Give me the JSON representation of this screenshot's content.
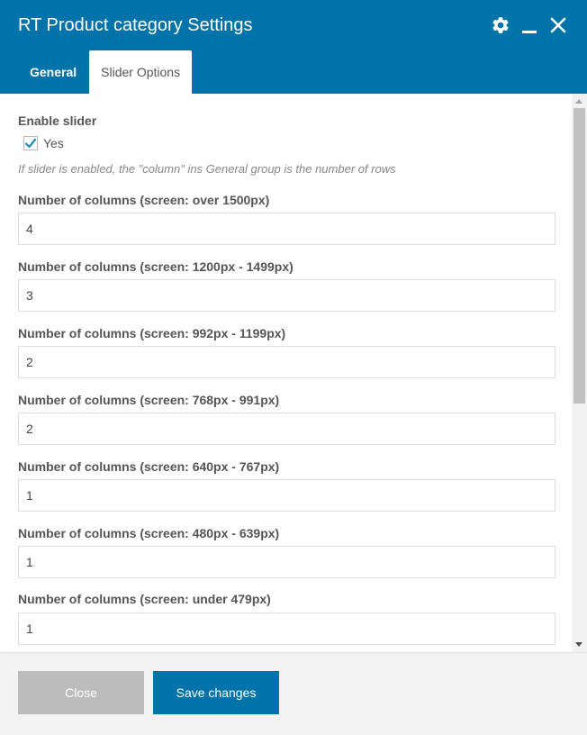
{
  "header": {
    "title": "RT Product category Settings",
    "controls": {
      "settings_icon": "gear-icon",
      "minimize_icon": "minimize-icon",
      "close_icon": "close-icon"
    },
    "tabs": [
      {
        "label": "General",
        "active": false
      },
      {
        "label": "Slider Options",
        "active": true
      }
    ]
  },
  "form": {
    "enable_slider": {
      "label": "Enable slider",
      "checkbox_label": "Yes",
      "checked": true,
      "help": "If slider is enabled, the \"column\" ins General group is the number of rows"
    },
    "fields": [
      {
        "label": "Number of columns (screen: over 1500px)",
        "value": "4"
      },
      {
        "label": "Number of columns (screen: 1200px - 1499px)",
        "value": "3"
      },
      {
        "label": "Number of columns (screen: 992px - 1199px)",
        "value": "2"
      },
      {
        "label": "Number of columns (screen: 768px - 991px)",
        "value": "2"
      },
      {
        "label": "Number of columns (screen: 640px - 767px)",
        "value": "1"
      },
      {
        "label": "Number of columns (screen: 480px - 639px)",
        "value": "1"
      },
      {
        "label": "Number of columns (screen: under 479px)",
        "value": "1"
      }
    ]
  },
  "footer": {
    "close_label": "Close",
    "save_label": "Save changes"
  },
  "colors": {
    "primary": "#0073aa",
    "disabled_button": "#bcbcbc",
    "footer_bg": "#f3f3f3"
  }
}
